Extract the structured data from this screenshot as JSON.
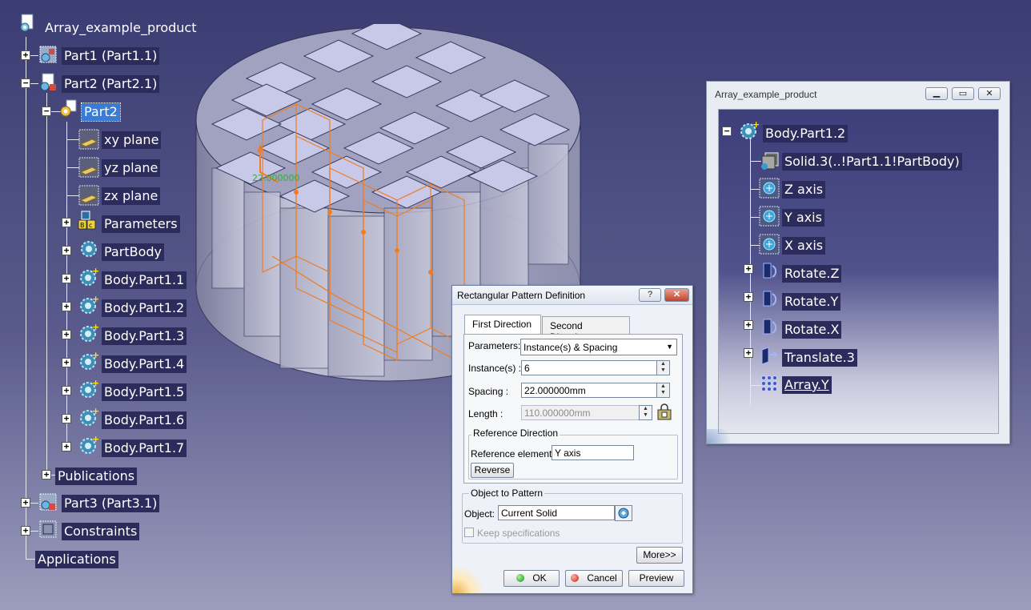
{
  "tree": {
    "root": "Array_example_product",
    "part1": "Part1 (Part1.1)",
    "part2": "Part2 (Part2.1)",
    "part2_doc": "Part2",
    "xy_plane": "xy plane",
    "yz_plane": "yz plane",
    "zx_plane": "zx plane",
    "parameters": "Parameters",
    "partbody": "PartBody",
    "bodies": [
      "Body.Part1.1",
      "Body.Part1.2",
      "Body.Part1.3",
      "Body.Part1.4",
      "Body.Part1.5",
      "Body.Part1.6",
      "Body.Part1.7"
    ],
    "publications": "Publications",
    "part3": "Part3 (Part3.1)",
    "constraints": "Constraints",
    "applications": "Applications"
  },
  "model": {
    "dimension_label": "22.000000",
    "colors": {
      "tile": "#c8c8e8",
      "cylinder": "#b9b9cc",
      "highlight": "#f07d1e"
    }
  },
  "dialog": {
    "title": "Rectangular Pattern Definition",
    "help_button": "?",
    "close_button": "✕",
    "tabs": [
      "First Direction",
      "Second Direction"
    ],
    "parameters_label": "Parameters:",
    "parameters_value": "Instance(s) & Spacing",
    "instances_label": "Instance(s) :",
    "instances_value": "6",
    "spacing_label": "Spacing :",
    "spacing_value": "22.000000mm",
    "length_label": "Length :",
    "length_value": "110.000000mm",
    "reference_direction_title": "Reference Direction",
    "reference_element_label": "Reference element:",
    "reference_element_value": "Y axis",
    "reverse_button": "Reverse",
    "object_to_pattern_title": "Object to Pattern",
    "object_label": "Object:",
    "object_value": "Current Solid",
    "keep_specifications": "Keep specifications",
    "more_button": "More>>",
    "ok_button": "OK",
    "cancel_button": "Cancel",
    "preview_button": "Preview"
  },
  "product_window": {
    "title": "Array_example_product",
    "items": {
      "body": "Body.Part1.2",
      "solid": "Solid.3(..!Part1.1!PartBody)",
      "z_axis": "Z axis",
      "y_axis": "Y axis",
      "x_axis": "X axis",
      "rotate_z": "Rotate.Z",
      "rotate_y": "Rotate.Y",
      "rotate_x": "Rotate.X",
      "translate": "Translate.3",
      "array": "Array.Y"
    }
  }
}
